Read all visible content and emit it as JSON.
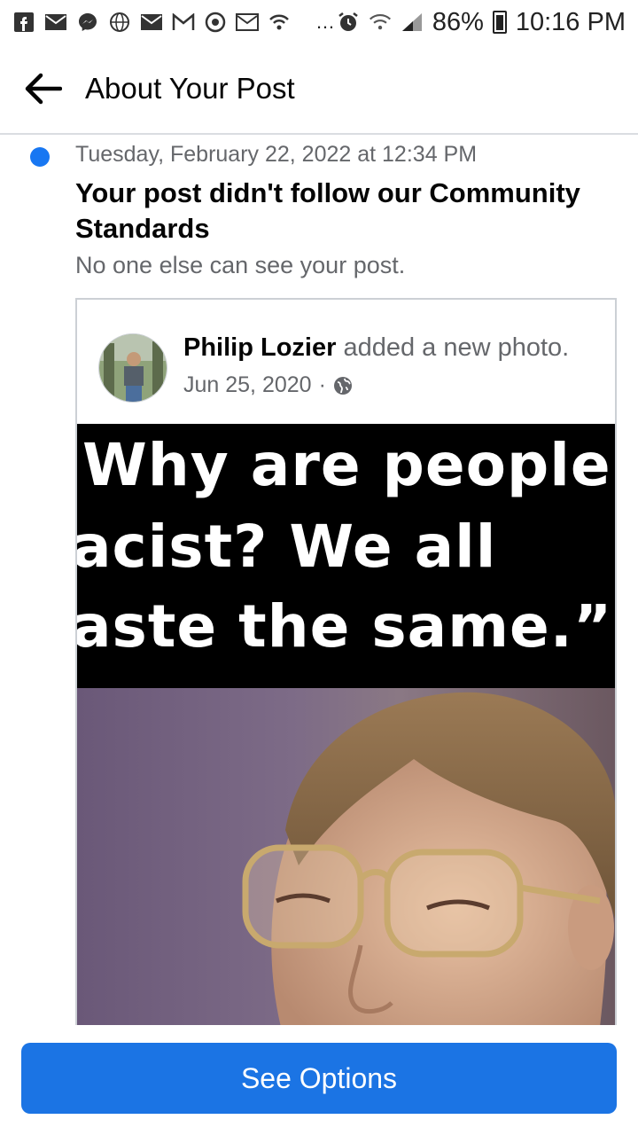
{
  "status_bar": {
    "left_icons": [
      "facebook-icon",
      "mail-icon",
      "messenger-icon",
      "globe-icon",
      "mail-icon",
      "gmail-icon",
      "chrome-icon",
      "mail-icon",
      "wifi-calling-icon"
    ],
    "more": "…",
    "battery": "86%",
    "time": "10:16 PM"
  },
  "header": {
    "title": "About Your Post"
  },
  "notice": {
    "date": "Tuesday, February 22, 2022 at 12:34 PM",
    "headline": "Your post didn't follow our Community Standards",
    "subtext": "No one else can see your post."
  },
  "post": {
    "author": "Philip Lozier",
    "action": "added a new photo.",
    "date": "Jun 25, 2020",
    "separator": "·",
    "privacy_icon": "globe-icon",
    "meme_lines": [
      "Why are people",
      "acist? We all",
      "aste the same.”"
    ]
  },
  "footer": {
    "button_label": "See Options"
  },
  "colors": {
    "accent": "#1877f2",
    "button": "#1b74e4",
    "secondary_text": "#65676b"
  }
}
